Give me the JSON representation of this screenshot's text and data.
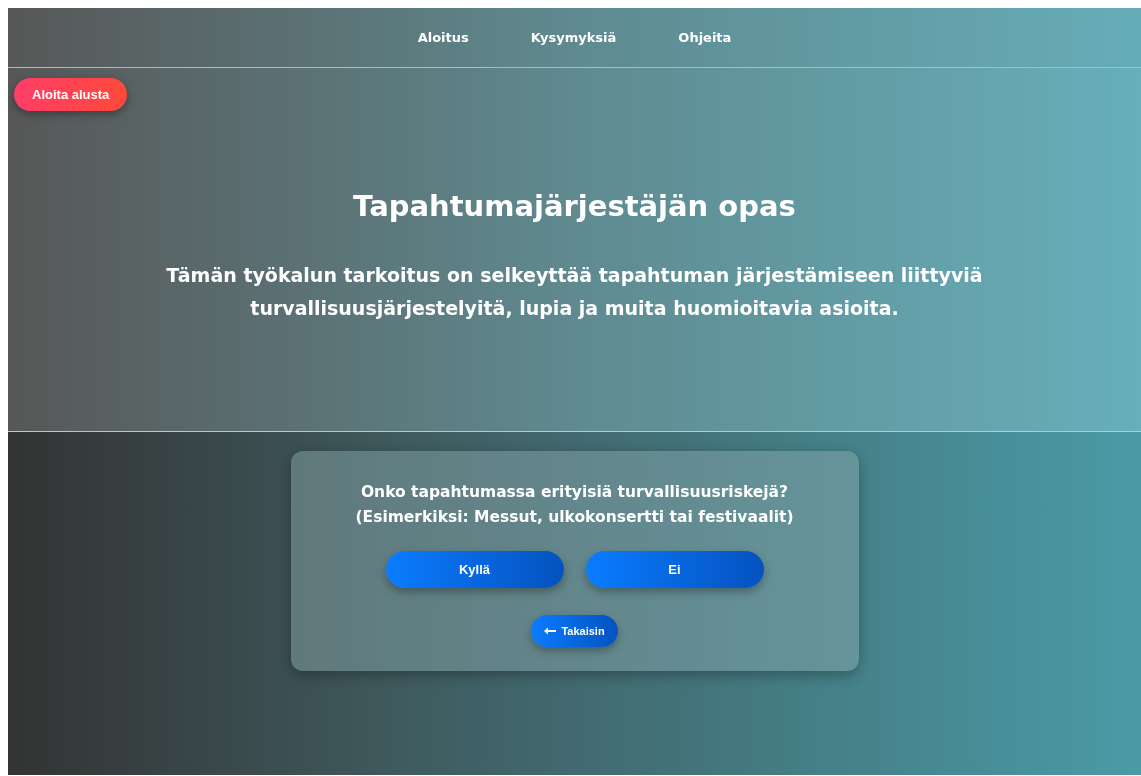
{
  "nav": {
    "links": [
      {
        "label": "Aloitus"
      },
      {
        "label": "Kysymyksiä"
      },
      {
        "label": "Ohjeita"
      }
    ]
  },
  "restart_button": {
    "label": "Aloita alusta"
  },
  "hero": {
    "title": "Tapahtumajärjestäjän opas",
    "lines": [
      "Tämän työkalun tarkoitus on selkeyttää tapahtuman järjestämiseen liittyviä",
      "turvallisuusjärjestelyitä, lupia ja muita huomioitavia asioita."
    ]
  },
  "question_card": {
    "question": "Onko tapahtumassa erityisiä turvallisuusriskejä?",
    "example": "(Esimerkiksi: Messut, ulkokonsertti tai festivaalit)",
    "answers": [
      {
        "label": "Kyllä"
      },
      {
        "label": "Ei"
      }
    ],
    "back_button": {
      "label": "Takaisin"
    }
  }
}
